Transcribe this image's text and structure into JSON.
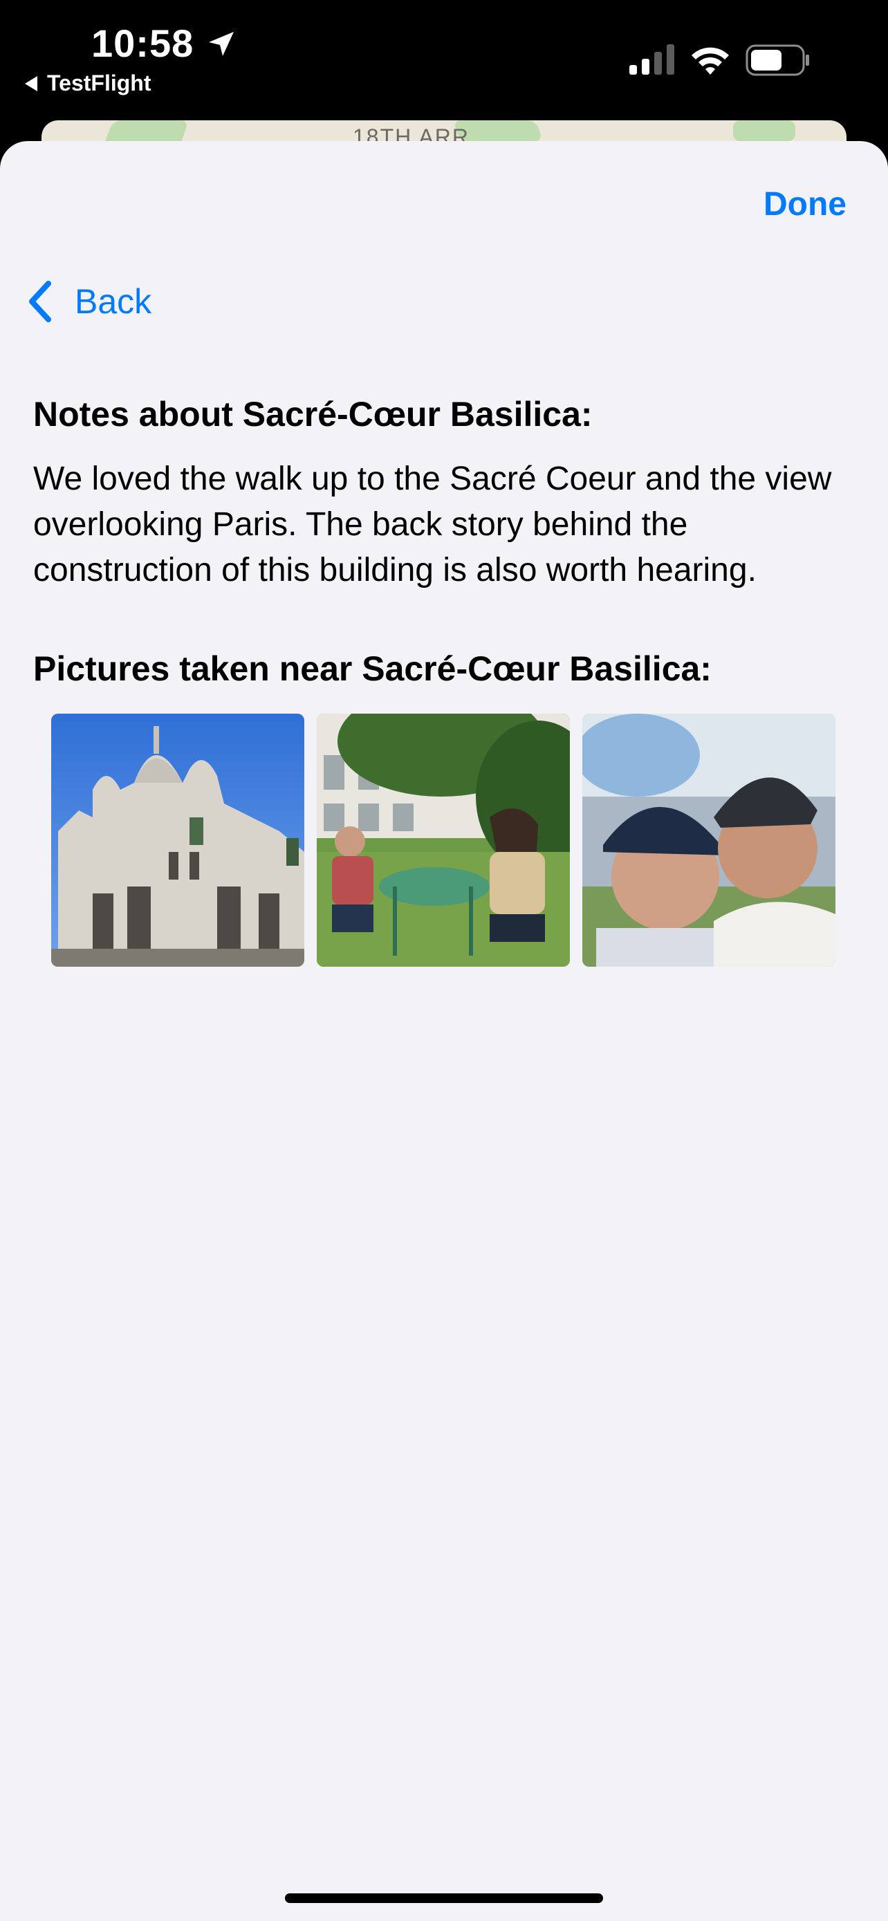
{
  "status_bar": {
    "time": "10:58",
    "back_app_label": "TestFlight",
    "icons": [
      "location-arrow-icon",
      "cellular-signal-icon",
      "wifi-icon",
      "battery-icon"
    ]
  },
  "map": {
    "label": "18TH ARR"
  },
  "sheet": {
    "done_label": "Done",
    "back_label": "Back",
    "notes_heading": "Notes about Sacré-Cœur Basilica:",
    "notes_body": "We loved the walk up to the Sacré Coeur and the view overlooking Paris. The back story behind the construction of this building is also worth hearing.",
    "pictures_heading": "Pictures taken near Sacré-Cœur Basilica:",
    "photos": [
      "basilica-photo",
      "cafe-table-photo",
      "selfie-photo"
    ]
  },
  "colors": {
    "accent": "#007aff",
    "sheet_background": "#f2f2f7",
    "status_bar_background": "#000000"
  }
}
